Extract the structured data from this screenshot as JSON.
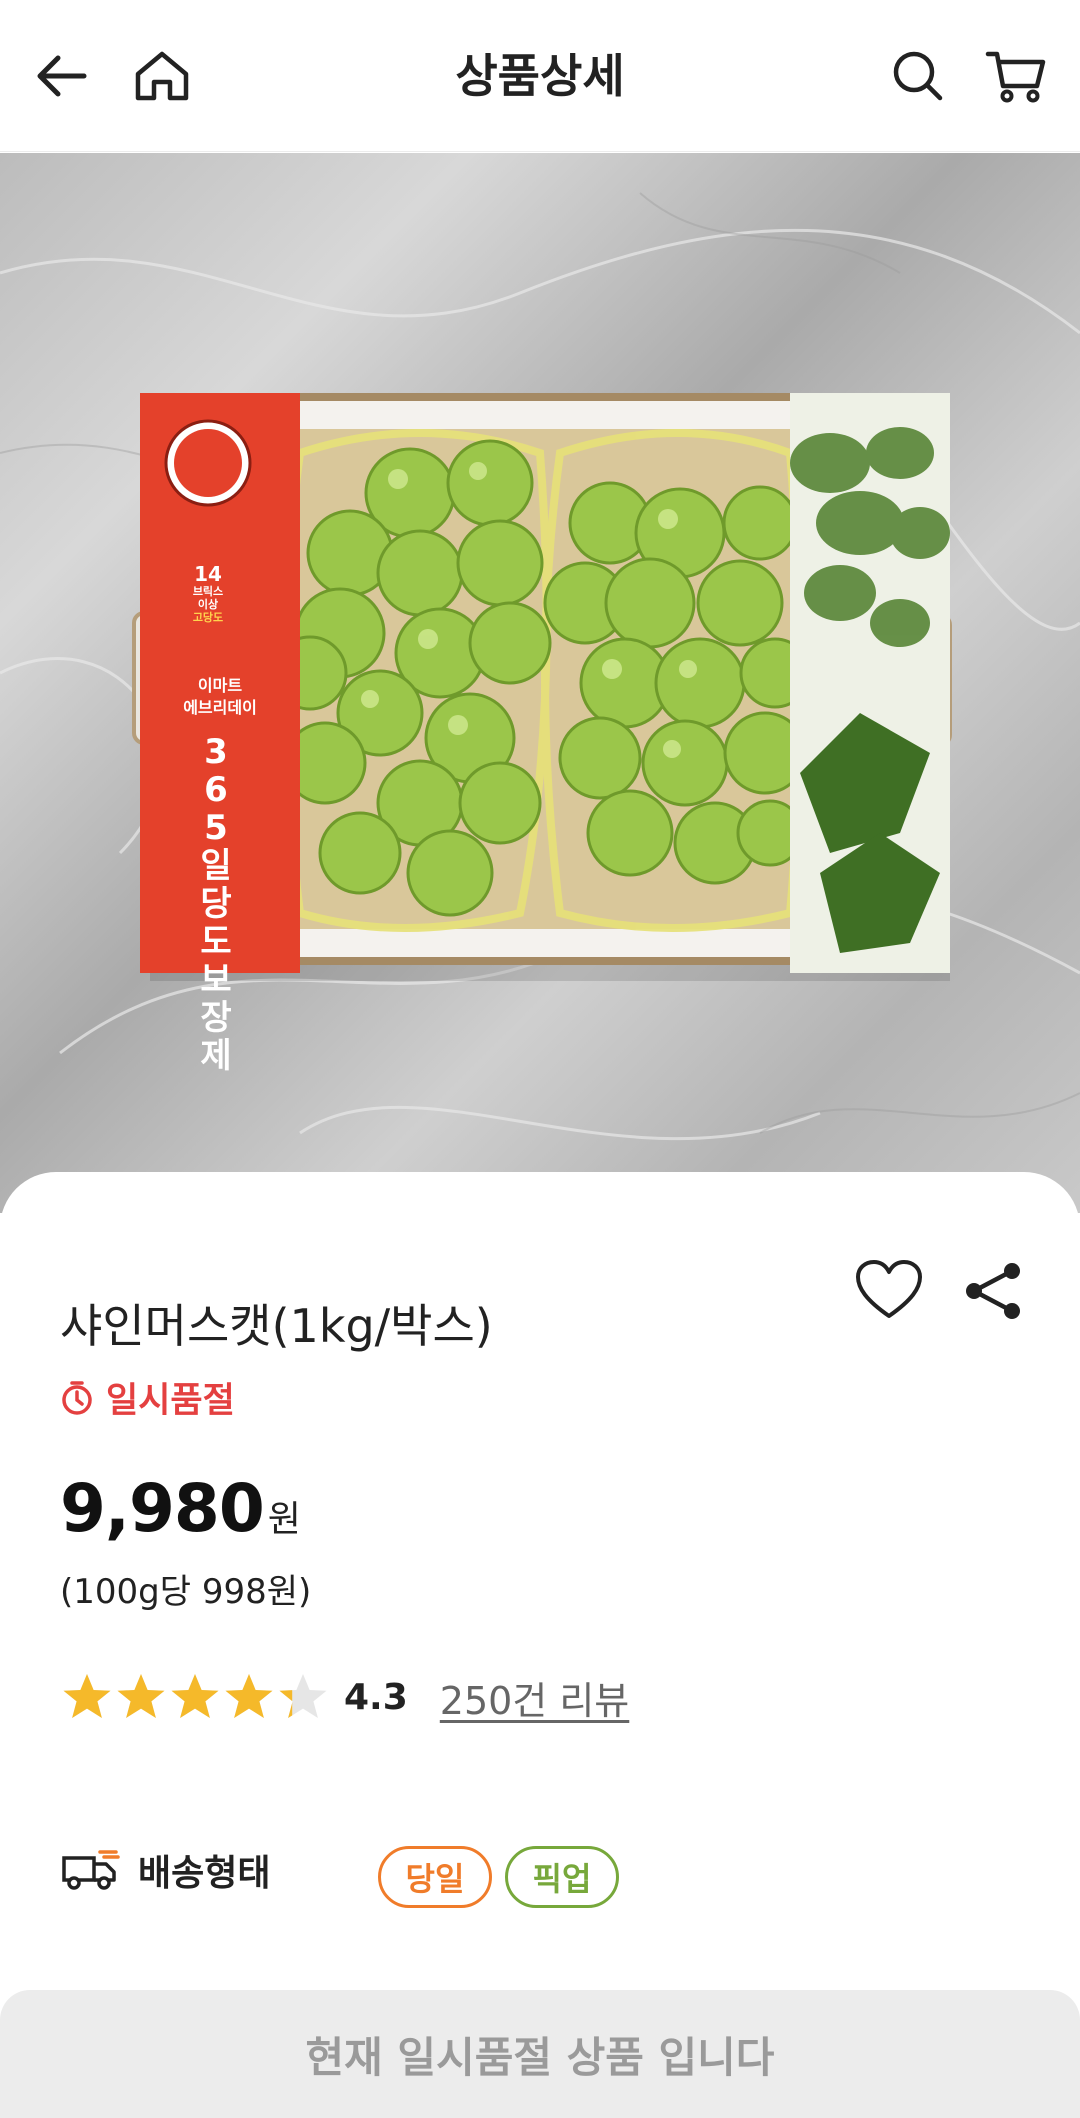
{
  "header": {
    "title": "상품상세",
    "back_icon": "back-arrow-icon",
    "home_icon": "home-icon",
    "search_icon": "search-icon",
    "cart_icon": "cart-icon"
  },
  "product_image": {
    "box_side_label_line1": "이마트",
    "box_side_label_line2": "에브리데이",
    "box_badge_top": "14",
    "box_badge_right_line1": "브릭스",
    "box_badge_right_line2": "이상",
    "box_badge_bottom": "고당도",
    "box_vertical_text": "365일 당도 보장제"
  },
  "product": {
    "name": "샤인머스캣(1kg/박스)",
    "status": "일시품절",
    "price": "9,980",
    "price_unit": "원",
    "unit_price": "(100g당 998원)",
    "rating": 4.3,
    "rating_text": "4.3",
    "review_count_text": "250건 리뷰"
  },
  "shipping": {
    "label": "배송형태",
    "options": [
      "당일",
      "픽업"
    ]
  },
  "bottom_button": {
    "label": "현재 일시품절 상품 입니다"
  },
  "colors": {
    "sold_out_red": "#e44040",
    "star_yellow": "#f5b92a",
    "sameday_orange": "#f07c2a",
    "pickup_green": "#77a83b",
    "box_red": "#e4412b"
  }
}
